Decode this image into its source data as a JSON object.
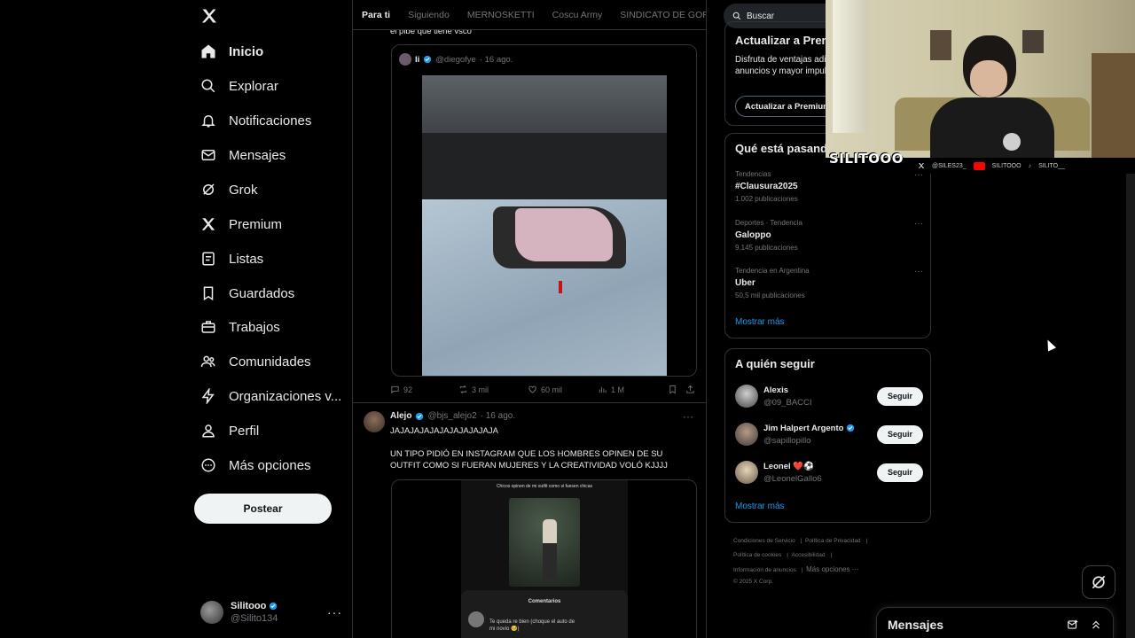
{
  "nav": {
    "items": [
      {
        "label": "Inicio",
        "icon": "home-icon"
      },
      {
        "label": "Explorar",
        "icon": "search-icon"
      },
      {
        "label": "Notificaciones",
        "icon": "bell-icon"
      },
      {
        "label": "Mensajes",
        "icon": "mail-icon"
      },
      {
        "label": "Grok",
        "icon": "grok-icon"
      },
      {
        "label": "Premium",
        "icon": "x-logo-icon"
      },
      {
        "label": "Listas",
        "icon": "list-icon"
      },
      {
        "label": "Guardados",
        "icon": "bookmark-icon"
      },
      {
        "label": "Trabajos",
        "icon": "briefcase-icon"
      },
      {
        "label": "Comunidades",
        "icon": "people-icon"
      },
      {
        "label": "Organizaciones v...",
        "icon": "lightning-icon"
      },
      {
        "label": "Perfil",
        "icon": "person-icon"
      },
      {
        "label": "Más opciones",
        "icon": "more-circle-icon"
      }
    ],
    "post_label": "Postear",
    "account": {
      "name": "Silitooo",
      "handle": "@Silito134"
    }
  },
  "tabs": [
    "Para ti",
    "Siguiendo",
    "MERNOSKETTI",
    "Coscu Army",
    "SINDICATO DE GORD"
  ],
  "feed": {
    "prev_text": "el pibe que tiene vsco",
    "quote": {
      "name": "Ii",
      "handle": "@diegofye",
      "time": "· 16 ago."
    },
    "actions": {
      "replies": "92",
      "reposts": "3 mil",
      "likes": "60 mil",
      "views": "1 M"
    },
    "tweet2": {
      "name": "Alejo",
      "handle": "@bjs_alejo2",
      "time": "· 16 ago.",
      "line1": "JAJAJAJAJAJAJAJAJAJAJA",
      "line2": "UN TIPO PIDIÓ EN INSTAGRAM QUE LOS HOMBRES OPINEN DE SU OUTFIT COMO SI FUERAN MUJERES Y LA CREATIVIDAD VOLÓ KJJJJ",
      "media_caption": "Chicos opinen de mi outfit como si fuesen chicas",
      "comments_title": "Comentarios",
      "comment": "Te queda re bien (choque el auto de mi novio 🥺)"
    }
  },
  "search": {
    "placeholder": "Buscar"
  },
  "premium": {
    "title": "Actualizar a Premium+",
    "desc": "Disfruta de ventajas adicionales, un total de anuncios y mayor impulso de tus respuestas.",
    "button": "Actualizar a Premium+"
  },
  "trends": {
    "title": "Qué está pasando",
    "items": [
      {
        "meta": "Tendencias",
        "name": "#Clausura2025",
        "count": "1.002 publicaciones"
      },
      {
        "meta": "Deportes · Tendencia",
        "name": "Galoppo",
        "count": "9.145 publicaciones"
      },
      {
        "meta": "Tendencia en Argentina",
        "name": "Uber",
        "count": "50,5 mil publicaciones"
      }
    ],
    "show_more": "Mostrar más"
  },
  "who_to_follow": {
    "title": "A quién seguir",
    "items": [
      {
        "name": "Alexis",
        "handle": "@09_BACCI",
        "button": "Seguir",
        "verified": false
      },
      {
        "name": "Jim Halpert Argento",
        "handle": "@sapillopillo",
        "button": "Seguir",
        "verified": true
      },
      {
        "name": "Leonel ❤️⚽",
        "handle": "@LeonelGallo6",
        "button": "Seguir",
        "verified": false
      }
    ],
    "show_more": "Mostrar más"
  },
  "footer": {
    "links": [
      "Condiciones de Servicio",
      "Política de Privacidad",
      "Política de cookies",
      "Accesibilidad",
      "Información de anuncios",
      "Más opciones ···"
    ],
    "copyright": "© 2025 X Corp."
  },
  "cam": {
    "brand": "SILITOOO",
    "socials": [
      "@SILES23_",
      "SILITOOO",
      "SILITO__"
    ]
  },
  "messages_dock": {
    "title": "Mensajes"
  },
  "colors": {
    "accent": "#1d9bf0",
    "background": "#000000",
    "border": "#2f3336",
    "muted": "#71767b"
  }
}
